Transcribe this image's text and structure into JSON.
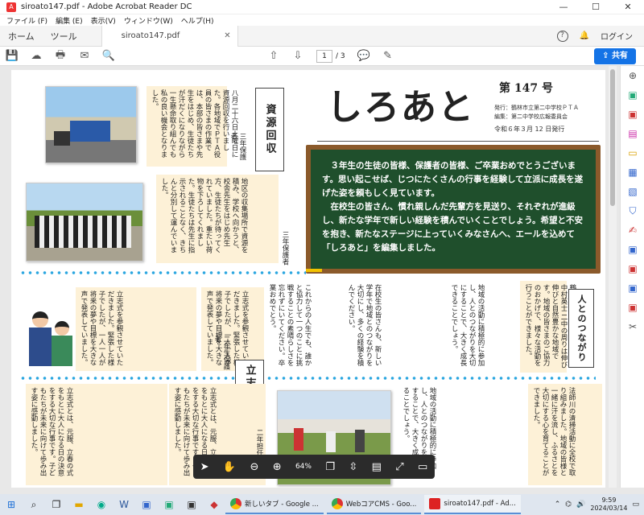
{
  "window": {
    "title": "siroato147.pdf - Adobe Acrobat Reader DC",
    "minimize": "—",
    "maximize": "☐",
    "close": "✕"
  },
  "menu": [
    "ファイル (F)",
    "編集 (E)",
    "表示(V)",
    "ウィンドウ(W)",
    "ヘルプ(H)"
  ],
  "tabs": {
    "home": "ホーム",
    "tools": "ツール",
    "doc": "siroato147.pdf",
    "login": "ログイン"
  },
  "toolbar": {
    "page_current": "1",
    "page_total": "/ 3",
    "share": "共有"
  },
  "document": {
    "title": "しろあと",
    "issue": "第 147 号",
    "publisher": "発行：鶴林市立第二中学校ＰＴＡ",
    "editor": "編集：第二中学校広報委員会",
    "date": "令和６年３月 12 日発行",
    "board_p1": "３年生の生徒の皆様、保護者の皆様、ご卒業おめでとうございます。思い起こせば、じつにたくさんの行事を経験して立派に成長を遂げた姿を頼もしく見ています。",
    "board_p2": "在校生の皆さん、慣れ親しんだ先輩方を見送り、それぞれが進級し、新たな学年で新しい経験を積んでいくことでしょう。希望と不安を抱き、新たなステージに上っていくみなさんへ、エールを込めて「しろあと」を編集しました。",
    "sec_resource": "資源回収",
    "sec_people": "人とのつながり",
    "sec_ambition": "立志式",
    "resource_text1": "八月二十六日土曜日に資源回収を行いました。各地域でＰＴＡ役員の皆さまの作業では、本部の皆さまや先生をはじめ、生徒たちが汗だくになりながら一生懸命取り組んでも私の良い機会となりました。",
    "resource_author1": "三年保護者",
    "resource_text2": "地区の収集場所で資源を積み、学校へ向かうと、校舎先生をはじめ先生方、生徒たちが待ってくれていました。重たい荷物を下ろしてくれました。生徒たちは先生に指示されることなく、きちんと分別して運んでいました。",
    "resource_author2": "三年保護者",
    "ambition_text1": "立志式を参観させていただきました。緊張した様子でしたが、一人一人が将来の夢や目標を大きな声で発表していました。",
    "ambition_author1": "二年生保護者",
    "ambition_text2": "立志式とは、元服、立春の式をもとに大人になる日の決意をする大切な行事です。子どもたちが未来に向けて歩み出す姿に感動しました。",
    "ambition_author2": "二年担任",
    "people_text1": "鶴林市立第二中学校 校長 中村英士 二中の周りは伸び伸びと自然豊かな地域です。地域の皆さまのご協力のおかげで、様々な活動を行うことができました。",
    "people_text2": "これからの人生でも、誰かと協力して一つのことに挑戦することの素晴らしさを忘れずにいてください。卒業おめでとう。",
    "people_text3": "在校生の皆さんも、新しい学年で地域とのつながりを大切にし、多くの経験を積んでください。",
    "people_text4": "地域の活動に積極的に参加し、人とのつながりを大切にすることで、大きく成長できることでしょう。",
    "bottom_text": "法師川の清掃活動に全校で取り組みました。地域の皆様と一緒に汗を流し、ふるさとを大切にする心を育てることができました。"
  },
  "floatbar": {
    "zoom": "64%"
  },
  "taskbar": {
    "app1": "新しいタブ - Google ...",
    "app2": "WebコアCMS - Goo...",
    "app3": "siroato147.pdf - Ad...",
    "time": "9:59",
    "date": "2024/03/14"
  }
}
